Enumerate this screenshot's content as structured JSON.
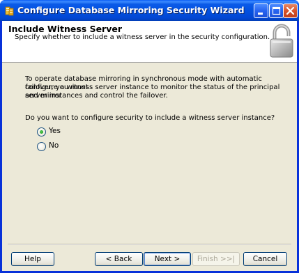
{
  "window": {
    "title": "Configure Database Mirroring Security Wizard"
  },
  "header": {
    "title": "Include Witness Server",
    "subtitle": "Specify whether to include a witness server in the security configuration."
  },
  "body": {
    "description_lines": [
      "To operate database mirroring in synchronous mode with automatic failover, you must",
      "configure a witness server instance to monitor the status of the principal and mirror",
      "server instances and control the failover."
    ],
    "question": "Do you want to configure security to include a witness server instance?",
    "options": [
      {
        "label": "Yes",
        "selected": true
      },
      {
        "label": "No",
        "selected": false
      }
    ]
  },
  "buttons": {
    "help": "Help",
    "back": "< Back",
    "next": "Next >",
    "finish": "Finish >>|",
    "cancel": "Cancel"
  },
  "colors": {
    "titlebar": "#0352e0",
    "client_bg": "#ece9d8",
    "header_bg": "#ffffff"
  }
}
